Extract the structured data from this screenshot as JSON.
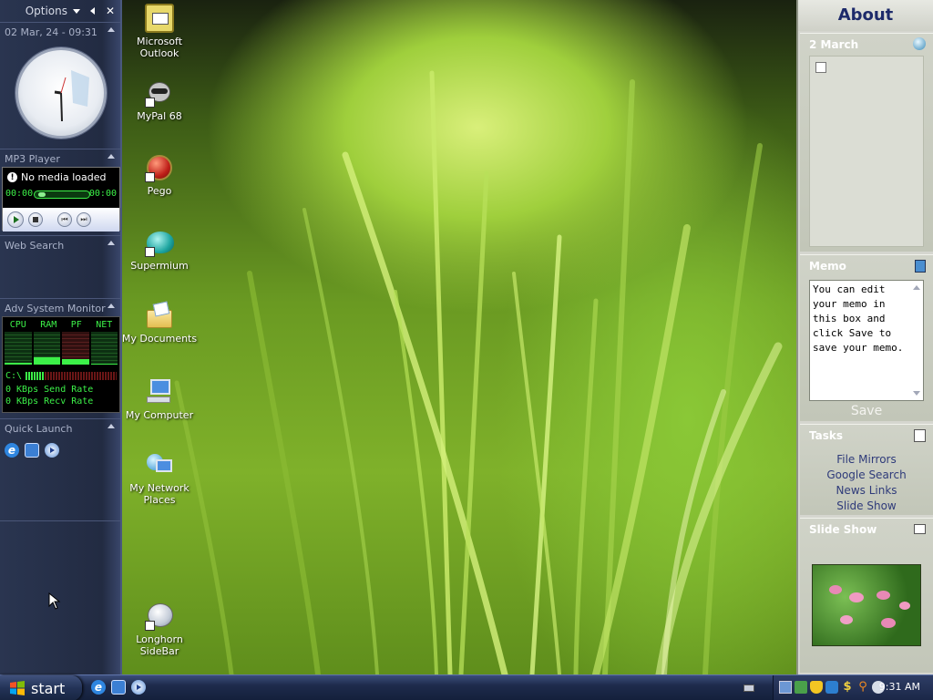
{
  "left_sidebar": {
    "options_label": "Options",
    "clock_header": "02 Mar, 24 - 09:31",
    "mp3": {
      "header": "MP3 Player",
      "status": "No media loaded",
      "time_start": "00:00",
      "time_end": "00:00",
      "progress": 0
    },
    "web_search_header": "Web Search",
    "monitor": {
      "header": "Adv System Monitor",
      "columns": [
        "CPU",
        "RAM",
        "PF",
        "NET"
      ],
      "drive": "C:\\",
      "send_rate": "0 KBps Send Rate",
      "recv_rate": "0 KBps Recv Rate"
    },
    "quick_launch_header": "Quick Launch"
  },
  "desktop": {
    "icons": [
      {
        "label": "Microsoft Outlook"
      },
      {
        "label": "MyPal 68"
      },
      {
        "label": "Pego"
      },
      {
        "label": "Supermium"
      },
      {
        "label": "My Documents"
      },
      {
        "label": "My Computer"
      },
      {
        "label": "My Network Places"
      },
      {
        "label": "Longhorn SideBar"
      }
    ]
  },
  "right_sidebar": {
    "about_title": "About",
    "calendar_date": "2 March",
    "memo_title": "Memo",
    "memo_text": "You can edit your memo in this box and click Save to save your memo.",
    "save_label": "Save",
    "tasks_title": "Tasks",
    "tasks": [
      "File Mirrors",
      "Google Search",
      "News Links",
      "Slide Show"
    ],
    "slideshow_title": "Slide Show"
  },
  "taskbar": {
    "start_label": "start",
    "clock": "9:31 AM"
  },
  "colors": {
    "accent_green": "#3cf048",
    "sidebar_dark": "#222b42",
    "sidebar_light": "#d5d6cf"
  }
}
